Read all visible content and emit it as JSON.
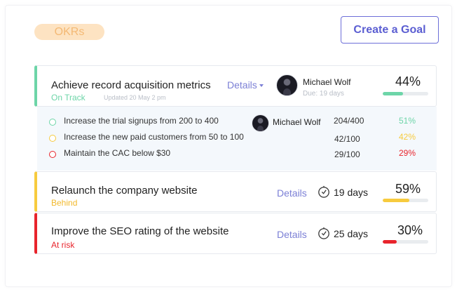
{
  "header": {
    "okr_pill": "OKRs",
    "create_button": "Create a Goal"
  },
  "colors": {
    "on_track": "#6dd5a8",
    "behind": "#f7cb3e",
    "at_risk": "#e8242c",
    "accent": "#5b5ed2"
  },
  "goals": [
    {
      "title": "Achieve record acquisition metrics",
      "status": "On Track",
      "updated": "Updated 20 May 2 pm",
      "details_label": "Details",
      "owner": "Michael Wolf",
      "due": "Due: 19 days",
      "percent_label": "44%",
      "progress": 0.44,
      "key_results": [
        {
          "text": "Increase the trial signups from 200 to 400",
          "owner": "Michael Wolf",
          "count": "204/400",
          "percent": "51%",
          "status": "on_track"
        },
        {
          "text": "Increase the new paid customers from 50 to 100",
          "count": "42/100",
          "percent": "42%",
          "status": "behind"
        },
        {
          "text": "Maintain the CAC below $30",
          "count": "29/100",
          "percent": "29%",
          "status": "at_risk"
        }
      ]
    },
    {
      "title": "Relaunch the company website",
      "status": "Behind",
      "details_label": "Details",
      "time_icon": "timer-icon",
      "days": "19 days",
      "percent_label": "59%",
      "progress": 0.59
    },
    {
      "title": "Improve the SEO rating of the website",
      "status": "At risk",
      "details_label": "Details",
      "time_icon": "timer-icon",
      "days": "25 days",
      "percent_label": "30%",
      "progress": 0.3
    }
  ]
}
